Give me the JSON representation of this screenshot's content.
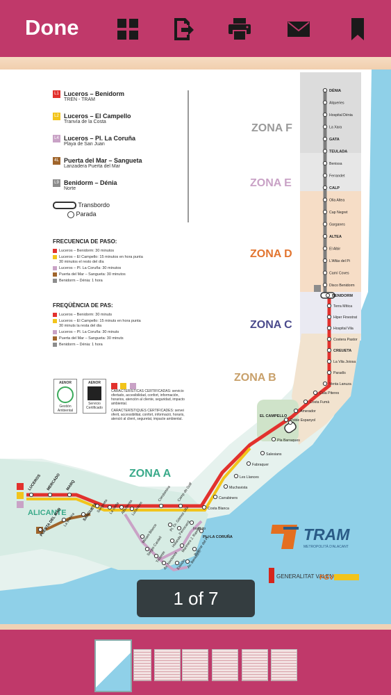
{
  "toolbar": {
    "done_label": "Done",
    "icons": [
      "grid-icon",
      "export-icon",
      "print-icon",
      "mail-icon",
      "bookmark-icon"
    ]
  },
  "page_indicator": "1 of 7",
  "legend": {
    "lines": [
      {
        "badge": "L1",
        "color": "#e2312d",
        "title": "Luceros – Benidorm",
        "subtitle": "TREN - TRAM"
      },
      {
        "badge": "L2",
        "color": "#f2c41b",
        "title": "Luceros – El Campello",
        "subtitle": "Tranvía de la Costa"
      },
      {
        "badge": "L4",
        "color": "#c9a2c6",
        "title": "Luceros – Pl. La Coruña",
        "subtitle": "Playa de San Juan"
      },
      {
        "badge": "4L",
        "color": "#a0652b",
        "title": "Puerta del Mar – Sangueta",
        "subtitle": "Lanzadera Puerta del Mar"
      },
      {
        "badge": "L9",
        "color": "#8c8c8c",
        "title": "Benidorm – Dénia",
        "subtitle": "Norte"
      }
    ],
    "transbordo": "Transbordo",
    "parada": "Parada"
  },
  "frecuencia": {
    "title": "FRECUENCIA DE PASO:",
    "items": [
      {
        "badge_color": "#e2312d",
        "text": "Luceros – Benidorm: 30 minutos"
      },
      {
        "badge_color": "#f2c41b",
        "text": "Luceros – El Campello: 15 minutos en hora punta",
        "text2": "30 minutos el resto del día"
      },
      {
        "badge_color": "#c9a2c6",
        "text": "Luceros – Pl. La Coruña: 30 minutos"
      },
      {
        "badge_color": "#a0652b",
        "text": "Puerta del Mar – Sangueta: 30 minutos"
      },
      {
        "badge_color": "#8c8c8c",
        "text": "Benidorm – Dénia: 1 hora"
      }
    ]
  },
  "frequencia": {
    "title": "FREQÜÈNCIA DE PAS:",
    "items": [
      {
        "badge_color": "#e2312d",
        "text": "Luceros – Benidorm: 30 minuts"
      },
      {
        "badge_color": "#f2c41b",
        "text": "Luceros – El Campello: 15 minuts en hora punta",
        "text2": "30 minuts la resta del dia"
      },
      {
        "badge_color": "#c9a2c6",
        "text": "Luceros – Pl. La Coruña: 30 minuts"
      },
      {
        "badge_color": "#a0652b",
        "text": "Puerta del Mar – Sangueta: 30 minuts"
      },
      {
        "badge_color": "#8c8c8c",
        "text": "Benidorm – Dénia: 1 hora"
      }
    ]
  },
  "certs": {
    "aenor1": "AENOR",
    "aenor1_sub": "Gestión Ambiental",
    "aenor2": "AENOR",
    "aenor2_sub": "Servicio Certificado",
    "cas": "CARACTERÍSTICAS CERTIFICADAS: servicio ofertado, accesibilidad, confort, información, horarios, atención al cliente, seguridad, impacto ambiental.",
    "val": "CARACTERÍSTIQUES CERTIFICADES: servei oferit, accessibilitat, confort, informació, horaris, atenció al client, seguretat, impacte ambiental."
  },
  "zones": [
    "ZONA F",
    "ZONA E",
    "ZONA D",
    "ZONA C",
    "ZONA B",
    "ZONA A"
  ],
  "zone_colors": {
    "F": "#9a9a9a",
    "E": "#c9a2c6",
    "D": "#e27530",
    "C": "#4a4a8c",
    "B": "#c8a06a",
    "A": "#3aaa8a"
  },
  "stations_north": [
    "DÉNIA",
    "Alqueries",
    "Hospital Dénia",
    "La Xara",
    "GATA",
    "TEULADA",
    "Benissa",
    "Ferrandet",
    "CALP",
    "Olla Altea",
    "Cap Negret",
    "Garganes",
    "ALTEA",
    "El Albir",
    "L'Alfàs del Pi",
    "Camí Coves",
    "Disco Benidorm",
    "BENIDORM",
    "Terra Mítica",
    "Hiper Finestrat",
    "Hospital Vila",
    "Costera Pastor",
    "CREUETA",
    "La Vila Joiosa",
    "Paradís",
    "Venta Lanuza",
    "Cala Piteres",
    "Costa Fumà",
    "Amerador",
    "Poble Espanyol"
  ],
  "stations_south": [
    "EL CAMPELLO",
    "Pla Barraques",
    "Salesians",
    "Fabraquer",
    "Les Llances",
    "Muchavista",
    "Carrabiners",
    "Costa Blanca",
    "Camp de Golf",
    "Condomina"
  ],
  "stations_city": [
    "LUCEROS",
    "MERCADO",
    "MARQ",
    "Sangueta",
    "La Isleta",
    "Albufereta",
    "Lucentum",
    "Miriam Blasco",
    "Sergio Cardell",
    "Tridente",
    "Av. Naciones",
    "Pl. Dr. Gómez Ulla",
    "Ferrocarril",
    "Instituto",
    "PL. LA CORUÑA",
    "Marinero J. Ramos",
    "Av. Benidorm",
    "Holanda",
    "Bulevar del Pla",
    "Estadio",
    "PUERTA DEL MAR",
    "La Marina",
    "SANGUETA"
  ],
  "city_label": "ALICANTE",
  "brand": {
    "name": "TRAM",
    "subtitle": "METROPOLITÀ D'ALACANT",
    "generalitat": "GENERALITAT VALENCIANA",
    "fgv": "FGV"
  },
  "thumbnail_count": 7
}
